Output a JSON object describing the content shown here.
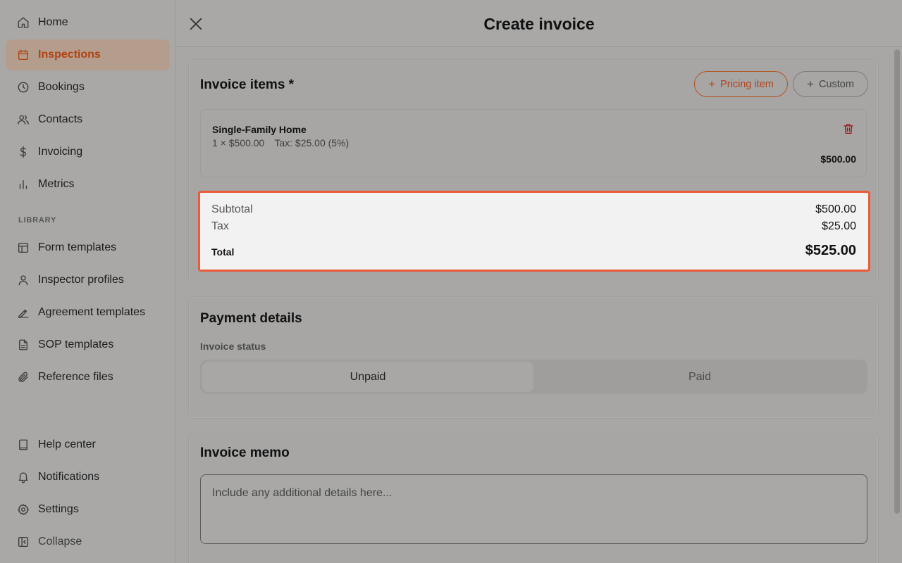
{
  "sidebar": {
    "items": [
      {
        "label": "Home",
        "icon": "home-icon"
      },
      {
        "label": "Inspections",
        "icon": "calendar-icon",
        "active": true
      },
      {
        "label": "Bookings",
        "icon": "clock-icon"
      },
      {
        "label": "Contacts",
        "icon": "users-icon"
      },
      {
        "label": "Invoicing",
        "icon": "dollar-icon"
      },
      {
        "label": "Metrics",
        "icon": "bar-chart-icon"
      }
    ],
    "library_label": "LIBRARY",
    "library_items": [
      {
        "label": "Form templates",
        "icon": "layout-icon"
      },
      {
        "label": "Inspector profiles",
        "icon": "user-icon"
      },
      {
        "label": "Agreement templates",
        "icon": "signature-icon"
      },
      {
        "label": "SOP templates",
        "icon": "file-text-icon"
      },
      {
        "label": "Reference files",
        "icon": "paperclip-icon"
      }
    ],
    "bottom_items": [
      {
        "label": "Help center",
        "icon": "book-icon"
      },
      {
        "label": "Notifications",
        "icon": "bell-icon"
      },
      {
        "label": "Settings",
        "icon": "gear-icon"
      },
      {
        "label": "Collapse",
        "icon": "sidebar-collapse-icon"
      }
    ]
  },
  "header": {
    "title": "Create invoice"
  },
  "invoice_items": {
    "title": "Invoice items *",
    "pricing_button": "Pricing item",
    "custom_button": "Custom",
    "items": [
      {
        "name": "Single-Family Home",
        "qty_price": "1 × $500.00",
        "tax": "Tax: $25.00 (5%)",
        "amount": "$500.00"
      }
    ]
  },
  "totals": {
    "subtotal_label": "Subtotal",
    "subtotal": "$500.00",
    "tax_label": "Tax",
    "tax": "$25.00",
    "total_label": "Total",
    "total": "$525.00"
  },
  "payment": {
    "title": "Payment details",
    "status_label": "Invoice status",
    "options": [
      "Unpaid",
      "Paid"
    ],
    "selected": "Unpaid"
  },
  "memo": {
    "title": "Invoice memo",
    "placeholder": "Include any additional details here...",
    "value": ""
  },
  "colors": {
    "accent": "#b1420f",
    "highlight_border": "#ec5a3a",
    "delete": "#9c1414"
  }
}
